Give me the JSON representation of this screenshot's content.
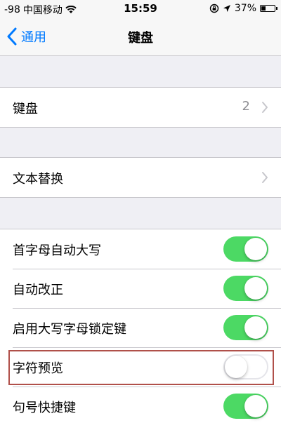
{
  "status_bar": {
    "signal": "-98",
    "carrier": "中国移动",
    "wifi_icon": "wifi-icon",
    "time": "15:59",
    "battery_percent": "37%",
    "battery_level": 0.37
  },
  "nav": {
    "back_label": "通用",
    "title": "键盘"
  },
  "section1": {
    "keyboards_label": "键盘",
    "keyboards_value": "2"
  },
  "section2": {
    "text_replacement_label": "文本替换"
  },
  "section3": {
    "rows": [
      {
        "label": "首字母自动大写",
        "on": true
      },
      {
        "label": "自动改正",
        "on": true
      },
      {
        "label": "启用大写字母锁定键",
        "on": true
      },
      {
        "label": "字符预览",
        "on": false
      },
      {
        "label": "句号快捷键",
        "on": true
      }
    ]
  },
  "colors": {
    "accent": "#007aff",
    "toggle_on": "#4cd964",
    "highlight": "#b0504a"
  }
}
